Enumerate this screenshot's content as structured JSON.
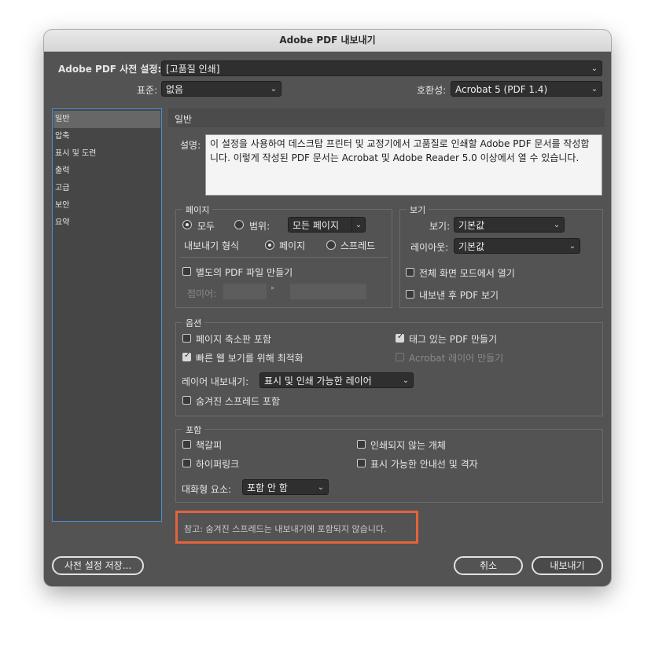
{
  "window": {
    "title": "Adobe PDF 내보내기"
  },
  "top": {
    "preset_label": "Adobe PDF 사전 설정:",
    "preset_value": "[고품질 인쇄]",
    "standard_label": "표준:",
    "standard_value": "없음",
    "compat_label": "호환성:",
    "compat_value": "Acrobat 5 (PDF 1.4)"
  },
  "sidebar": {
    "items": [
      "일반",
      "압축",
      "표시 및 도련",
      "출력",
      "고급",
      "보안",
      "요약"
    ],
    "active_index": 0
  },
  "content": {
    "heading": "일반",
    "description_label": "설명:",
    "description_text": "이 설정을 사용하여 데스크탑 프린터 및 교정기에서 고품질로 인쇄할 Adobe PDF 문서를 작성합니다. 이렇게 작성된 PDF 문서는 Acrobat 및 Adobe Reader 5.0 이상에서 열 수 있습니다."
  },
  "pages": {
    "title": "페이지",
    "all_label": "모두",
    "range_label": "범위:",
    "range_value": "모든 페이지",
    "export_as_label": "내보내기 형식",
    "pages_label": "페이지",
    "spreads_label": "스프레드",
    "separate_pdf_label": "별도의 PDF 파일 만들기",
    "suffix_label": "접미어:"
  },
  "view": {
    "title": "보기",
    "view_label": "보기:",
    "view_value": "기본값",
    "layout_label": "레이아웃:",
    "layout_value": "기본값",
    "fullscreen_label": "전체 화면 모드에서 열기",
    "view_after_label": "내보낸 후 PDF 보기"
  },
  "options": {
    "title": "옵션",
    "thumbnails_label": "페이지 축소판 포함",
    "tagged_pdf_label": "태그 있는 PDF 만들기",
    "fast_web_label": "빠른 웹 보기를 위해 최적화",
    "acrobat_layers_label": "Acrobat 레이어 만들기",
    "export_layers_label": "레이어 내보내기:",
    "export_layers_value": "표시 및 인쇄 가능한 레이어",
    "hidden_spreads_label": "숨겨진 스프레드 포함"
  },
  "include": {
    "title": "포함",
    "bookmarks_label": "책갈피",
    "non_printing_label": "인쇄되지 않는 개체",
    "hyperlinks_label": "하이퍼링크",
    "guides_label": "표시 가능한 안내선 및 격자",
    "interactive_label": "대화형 요소:",
    "interactive_value": "포함 안 함"
  },
  "note": {
    "text": "참고: 숨겨진 스프레드는 내보내기에 포함되지 않습니다."
  },
  "buttons": {
    "save_preset": "사전 설정 저장...",
    "cancel": "취소",
    "export": "내보내기"
  },
  "colors": {
    "highlight": "#e4643a",
    "focus": "#4a90d9"
  }
}
